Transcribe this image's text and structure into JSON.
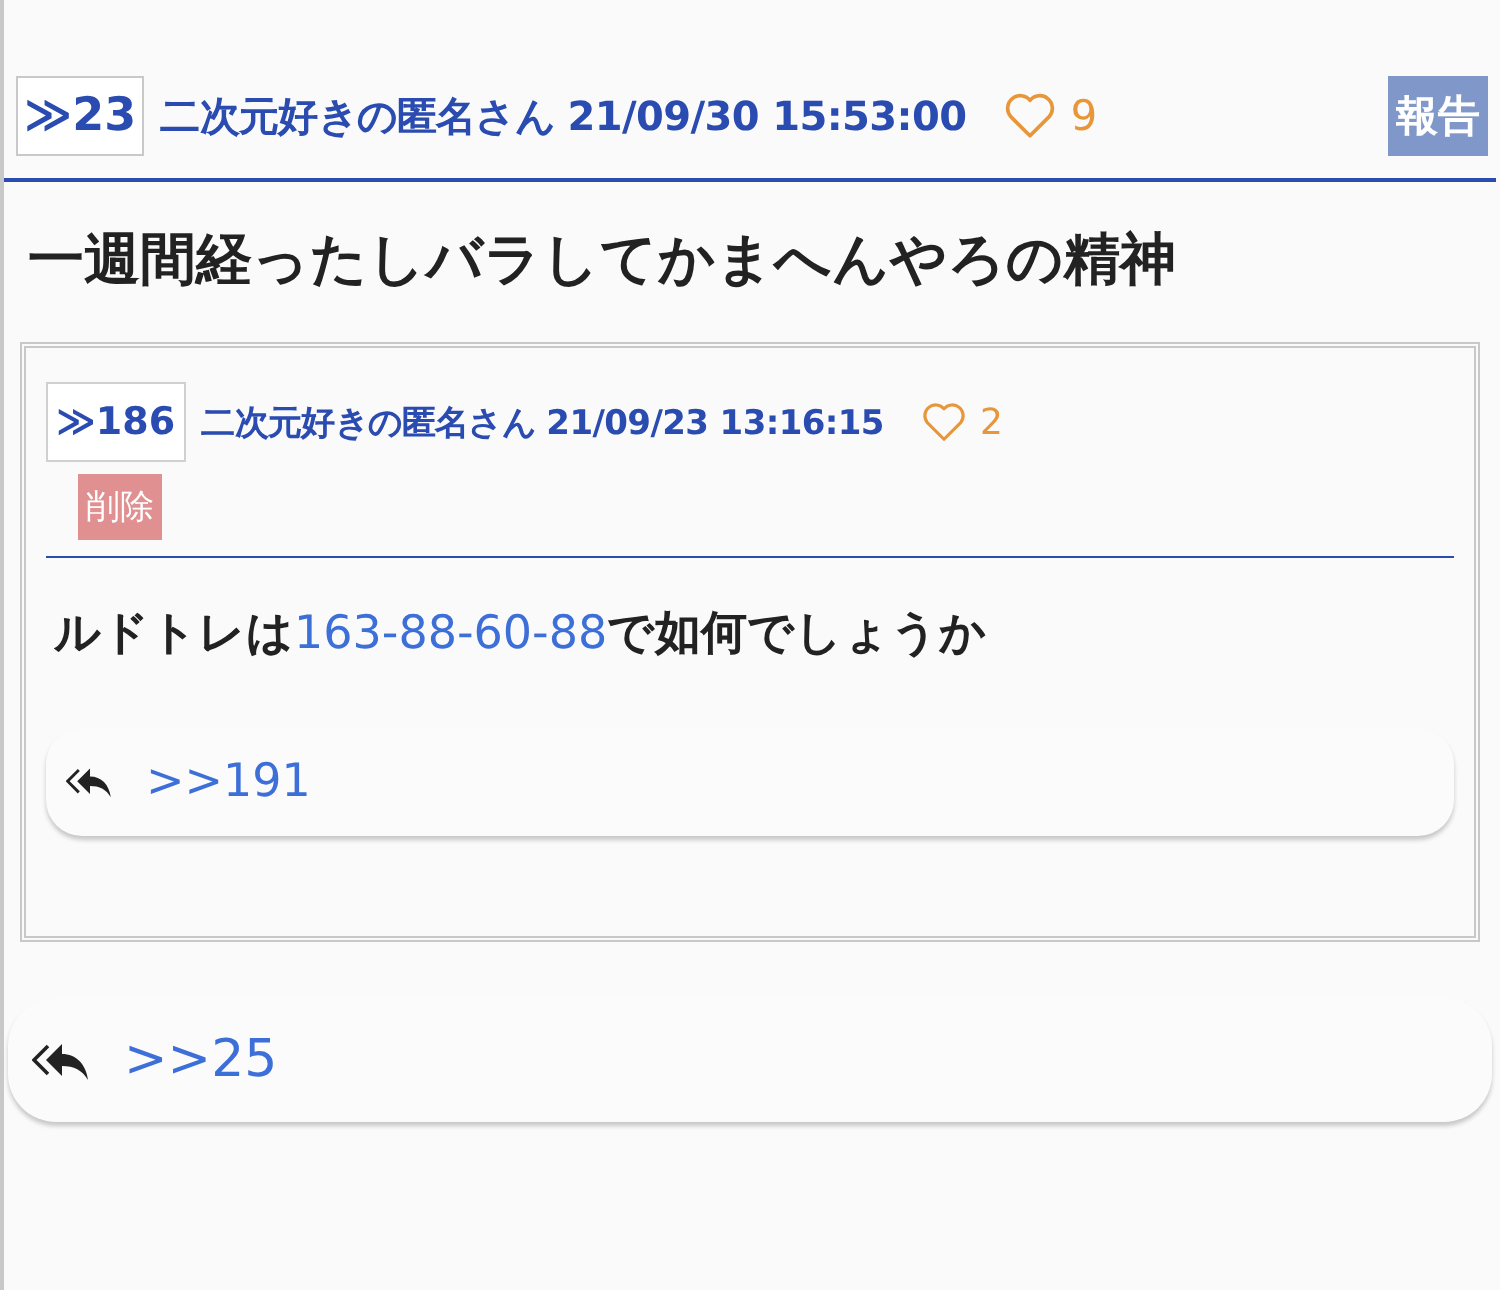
{
  "post": {
    "number": "≫23",
    "author_date": "二次元好きの匿名さん 21/09/30 15:53:00",
    "likes": "9",
    "report_label": "報告",
    "body": "一週間経ったしバラしてかまへんやろの精神"
  },
  "quote": {
    "number": "≫186",
    "author_date": "二次元好きの匿名さん 21/09/23 13:16:15",
    "likes": "2",
    "delete_label": "削除",
    "body": [
      {
        "kind": "text",
        "text": "ルドトレは"
      },
      {
        "kind": "link",
        "text": "163-88-60-88"
      },
      {
        "kind": "text",
        "text": "で如何でしょうか"
      }
    ],
    "replies": [
      ">>191"
    ]
  },
  "replies": [
    ">>25"
  ]
}
